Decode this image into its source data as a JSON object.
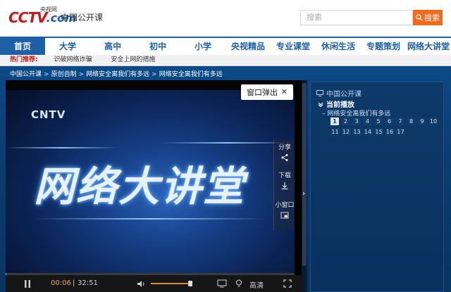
{
  "header": {
    "logo_text": "CCTV",
    "logo_com": ".com",
    "logo_cn": "央视网",
    "site_name": "中国公开课",
    "search_placeholder": "搜索",
    "search_button": "搜索",
    "brand_color": "#c8161d",
    "accent_color": "#1e5fa8",
    "search_color": "#f26a1b"
  },
  "nav": {
    "items": [
      "首页",
      "大学",
      "高中",
      "初中",
      "小学",
      "央视精品",
      "专业课堂",
      "休闲生活",
      "专题策划",
      "网络大讲堂"
    ],
    "active_index": 0
  },
  "hot": {
    "label": "热门推荐:",
    "links": [
      "识破网络诈骗",
      "安全上网的措施"
    ]
  },
  "breadcrumb": {
    "items": [
      "中国公开课",
      "原创自制",
      "网络安全离我们有多远",
      "网络安全离我们有多远"
    ],
    "separator": ">"
  },
  "player": {
    "brand_mark": "CNTV",
    "title_art": "网络大讲堂",
    "popup_label": "窗口弹出",
    "popup_close": "✕",
    "share_label": "分享",
    "download_label": "下载",
    "mini_label": "小窗口",
    "time_current": "00:06",
    "time_separator": "|",
    "time_total": "32:51",
    "quality_label": "高清",
    "progress_fraction": 0.003,
    "volume_fraction": 0.9
  },
  "playlist": {
    "header": "中国公开课",
    "now_playing_label": "当前播放",
    "item_title": "网络安全离我们有多远",
    "episodes": [
      "1",
      "2",
      "3",
      "4",
      "5",
      "6",
      "7",
      "8",
      "9",
      "10",
      "11",
      "12",
      "13",
      "14",
      "15",
      "16",
      "17"
    ],
    "active_episode": "1"
  }
}
